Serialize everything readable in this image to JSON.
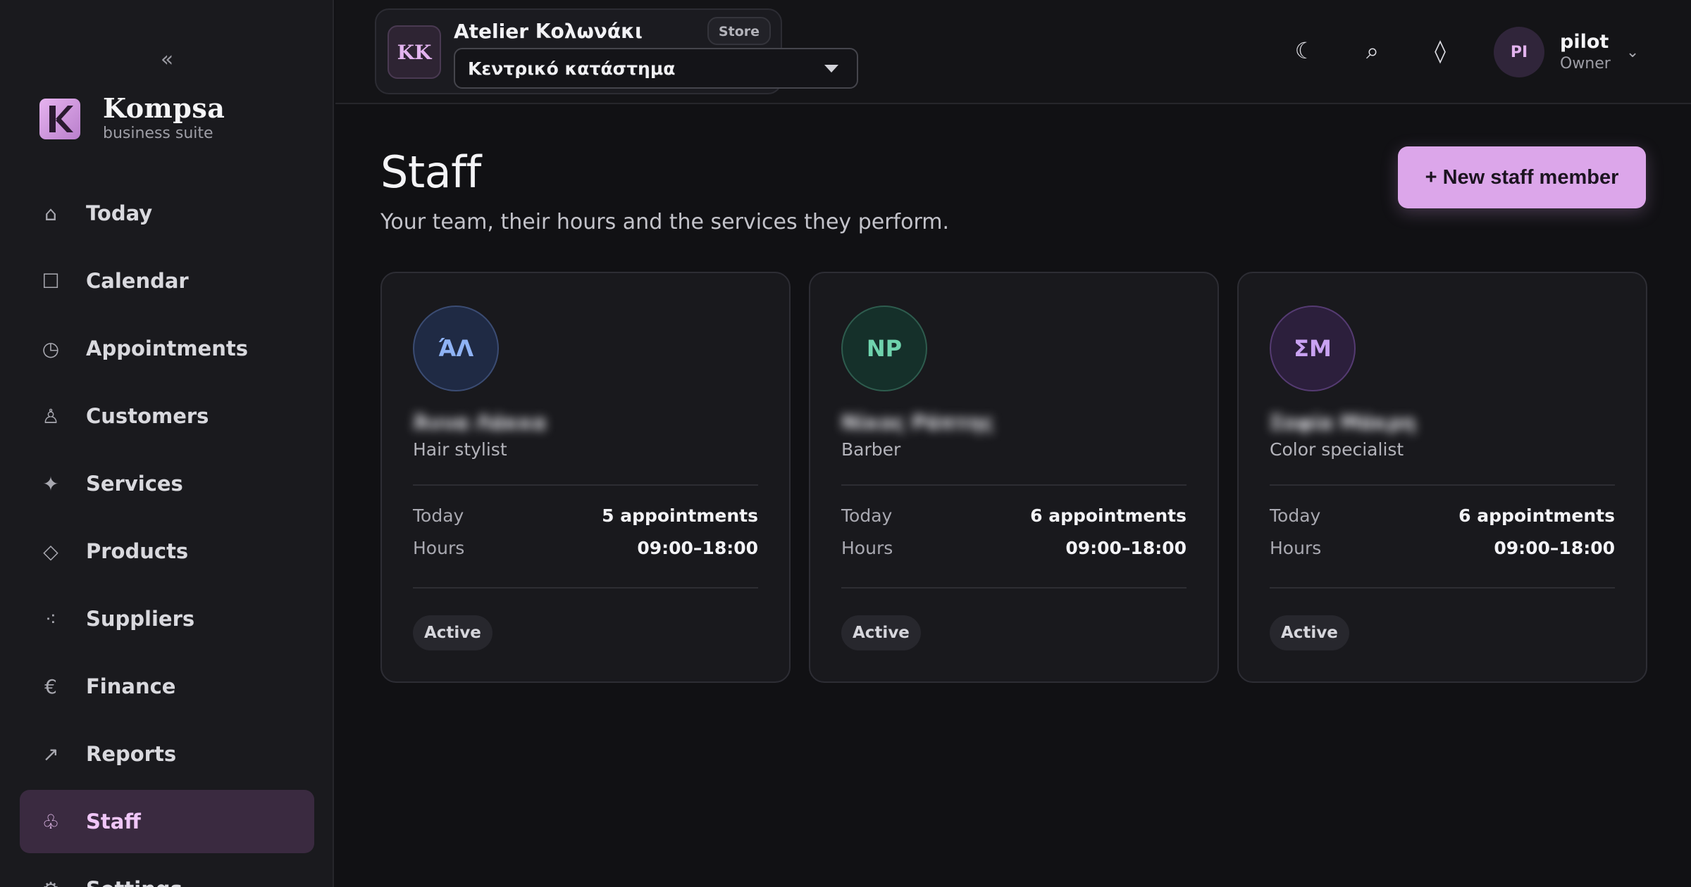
{
  "sidebar": {
    "collapse_icon": "«",
    "brand": {
      "name": "Kompsa",
      "tagline": "business suite"
    },
    "items": [
      {
        "key": "today",
        "label": "Today",
        "icon": "⌂",
        "icon_name": "home-icon"
      },
      {
        "key": "calendar",
        "label": "Calendar",
        "icon": "☐",
        "icon_name": "calendar-icon"
      },
      {
        "key": "appointments",
        "label": "Appointments",
        "icon": "◷",
        "icon_name": "clock-icon"
      },
      {
        "key": "customers",
        "label": "Customers",
        "icon": "♙",
        "icon_name": "person-icon"
      },
      {
        "key": "services",
        "label": "Services",
        "icon": "✦",
        "icon_name": "sparkle-icon"
      },
      {
        "key": "products",
        "label": "Products",
        "icon": "◇",
        "icon_name": "diamond-icon"
      },
      {
        "key": "suppliers",
        "label": "Suppliers",
        "icon": "⁖",
        "icon_name": "dots-icon"
      },
      {
        "key": "finance",
        "label": "Finance",
        "icon": "€",
        "icon_name": "euro-icon"
      },
      {
        "key": "reports",
        "label": "Reports",
        "icon": "↗",
        "icon_name": "trend-arrow-icon"
      },
      {
        "key": "staff",
        "label": "Staff",
        "icon": "♧",
        "icon_name": "staff-icon",
        "active": true
      },
      {
        "key": "settings",
        "label": "Settings",
        "icon": "⚙",
        "icon_name": "gear-icon"
      }
    ]
  },
  "topbar": {
    "store": {
      "initials": "KK",
      "name": "Atelier Κολωνάκι",
      "tag": "Store",
      "location": "Κεντρικό κατάστημα"
    },
    "icons": {
      "theme": "☾",
      "search": "⌕",
      "diamond": "◊"
    },
    "user": {
      "initials": "PI",
      "name": "pilot",
      "role": "Owner",
      "caret": "⌄"
    }
  },
  "page": {
    "title": "Staff",
    "subtitle": "Your team, their hours and the services they perform.",
    "new_button": "+ New staff member"
  },
  "staff": [
    {
      "initials": "ΆΛ",
      "name": "Άννα Λάκκα",
      "role": "Hair stylist",
      "today_label": "Today",
      "today_value": "5 appointments",
      "hours_label": "Hours",
      "hours_value": "09:00–18:00",
      "status": "Active",
      "avatar_bg": "#1f2a44",
      "avatar_border": "#3b4c73",
      "avatar_fg": "#8fb3f5"
    },
    {
      "initials": "NP",
      "name": "Νίκος Ράπτης",
      "role": "Barber",
      "today_label": "Today",
      "today_value": "6 appointments",
      "hours_label": "Hours",
      "hours_value": "09:00–18:00",
      "status": "Active",
      "avatar_bg": "#15302a",
      "avatar_border": "#2e5c4e",
      "avatar_fg": "#6fd3ad"
    },
    {
      "initials": "ΣΜ",
      "name": "Σοφία Μάκρη",
      "role": "Color specialist",
      "today_label": "Today",
      "today_value": "6 appointments",
      "hours_label": "Hours",
      "hours_value": "09:00–18:00",
      "status": "Active",
      "avatar_bg": "#2c1f3c",
      "avatar_border": "#553b72",
      "avatar_fg": "#c9a2f2"
    }
  ],
  "colors": {
    "accent": "#dca6ea",
    "active_nav_bg": "#3a2a40",
    "background": "#111114"
  }
}
